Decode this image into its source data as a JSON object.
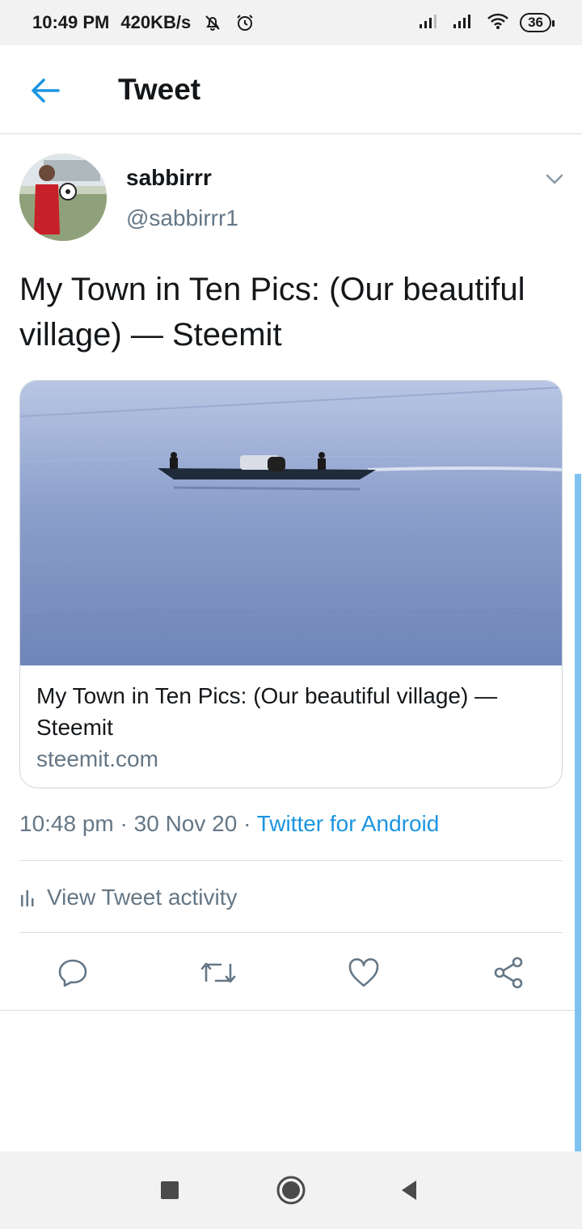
{
  "status_bar": {
    "time": "10:49 PM",
    "net_speed": "420KB/s",
    "icons": [
      "mute-icon",
      "alarm-icon",
      "signal-icon",
      "signal-icon",
      "wifi-icon"
    ],
    "battery": "36"
  },
  "header": {
    "back_icon": "back-arrow-icon",
    "title": "Tweet"
  },
  "tweet": {
    "author": {
      "name": "sabbirrr",
      "handle": "@sabbirrr1",
      "avatar_desc": "avatar-photo"
    },
    "text": "My Town in Ten Pics: (Our beautiful village) — Steemit",
    "card": {
      "title": "My Town in Ten Pics: (Our beautiful village) — Steemit",
      "domain": "steemit.com"
    },
    "time": "10:48 pm",
    "date": "30 Nov 20",
    "separator": "·",
    "source": "Twitter for Android",
    "activity_label": "View Tweet activity",
    "actions": [
      "reply-icon",
      "retweet-icon",
      "like-icon",
      "share-icon"
    ]
  },
  "colors": {
    "accent": "#1b95e0",
    "secondary_text": "#657786",
    "primary_text": "#14171a",
    "divider": "#d7dde2",
    "scrollbar": "#7ec3ef"
  },
  "nav_bar": {
    "buttons": [
      "recents-icon",
      "home-icon",
      "back-icon"
    ]
  }
}
